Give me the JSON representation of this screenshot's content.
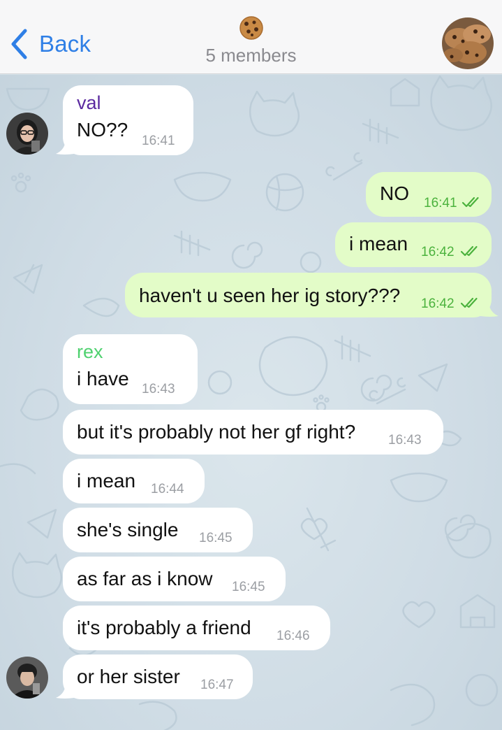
{
  "header": {
    "back_label": "Back",
    "members_label": "5 members",
    "chat_icon": "cookie-emoji",
    "group_avatar": "cookies-photo"
  },
  "colors": {
    "accent": "#2f7fe6",
    "incoming_bubble": "#ffffff",
    "outgoing_bubble": "#e3fcc8",
    "read_ticks": "#4bb23d",
    "sender_val": "#5b2aa0",
    "sender_rex": "#4fd16f"
  },
  "messages": [
    {
      "sender": "val",
      "text": "NO??",
      "time": "16:41"
    },
    {
      "text": "NO",
      "time": "16:41"
    },
    {
      "text": "i mean",
      "time": "16:42"
    },
    {
      "text": "haven't u seen her ig story???",
      "time": "16:42"
    },
    {
      "sender": "rex",
      "text": "i have",
      "time": "16:43"
    },
    {
      "text": "but it's probably not her gf right?",
      "time": "16:43"
    },
    {
      "text": "i mean",
      "time": "16:44"
    },
    {
      "text": "she's single",
      "time": "16:45"
    },
    {
      "text": "as far as i know",
      "time": "16:45"
    },
    {
      "text": "it's probably a friend",
      "time": "16:46"
    },
    {
      "text": "or her sister",
      "time": "16:47"
    }
  ]
}
